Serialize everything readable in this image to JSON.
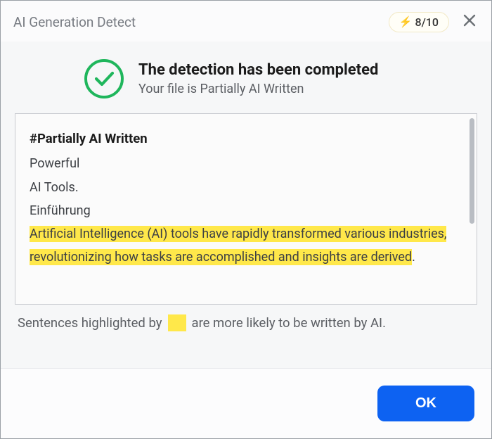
{
  "titlebar": {
    "title": "AI Generation Detect",
    "badge": "8/10"
  },
  "status": {
    "heading": "The detection has been completed",
    "sub": "Your file is Partially AI Written"
  },
  "results": {
    "heading": "#Partially AI Written",
    "line1": "Powerful",
    "line2": "AI Tools.",
    "line3": "Einführung",
    "highlighted": "Artificial Intelligence (AI) tools have rapidly transformed various industries, revolutionizing how tasks are accomplished and insights are derived",
    "period": "."
  },
  "legend": {
    "before": "Sentences highlighted by",
    "after": "are more likely to be written by AI."
  },
  "footer": {
    "ok": "OK"
  }
}
